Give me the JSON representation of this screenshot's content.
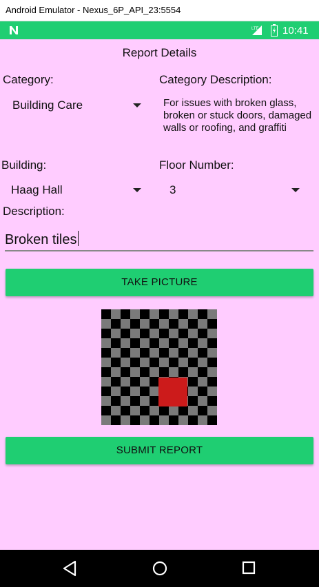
{
  "window": {
    "title": "Android Emulator - Nexus_6P_API_23:5554"
  },
  "status_bar": {
    "network_label": "LTE",
    "time": "10:41",
    "color": "#1fce72"
  },
  "screen": {
    "title": "Report Details"
  },
  "form": {
    "category_label": "Category:",
    "category_value": "Building Care",
    "category_description_label": "Category Description:",
    "category_description": "For issues with broken glass, broken or stuck doors, damaged walls or roofing, and graffiti",
    "building_label": "Building:",
    "building_value": "Haag Hall",
    "floor_label": "Floor Number:",
    "floor_value": "3",
    "description_label": "Description:",
    "description_value": "Broken tiles"
  },
  "buttons": {
    "take_picture": "TAKE PICTURE",
    "submit_report": "SUBMIT REPORT"
  },
  "colors": {
    "background": "#ffccff",
    "accent": "#1fce72"
  },
  "icons": [
    "n-logo-icon",
    "lte-signal-icon",
    "battery-icon",
    "back-icon",
    "home-icon",
    "recents-icon",
    "dropdown-caret-icon"
  ]
}
